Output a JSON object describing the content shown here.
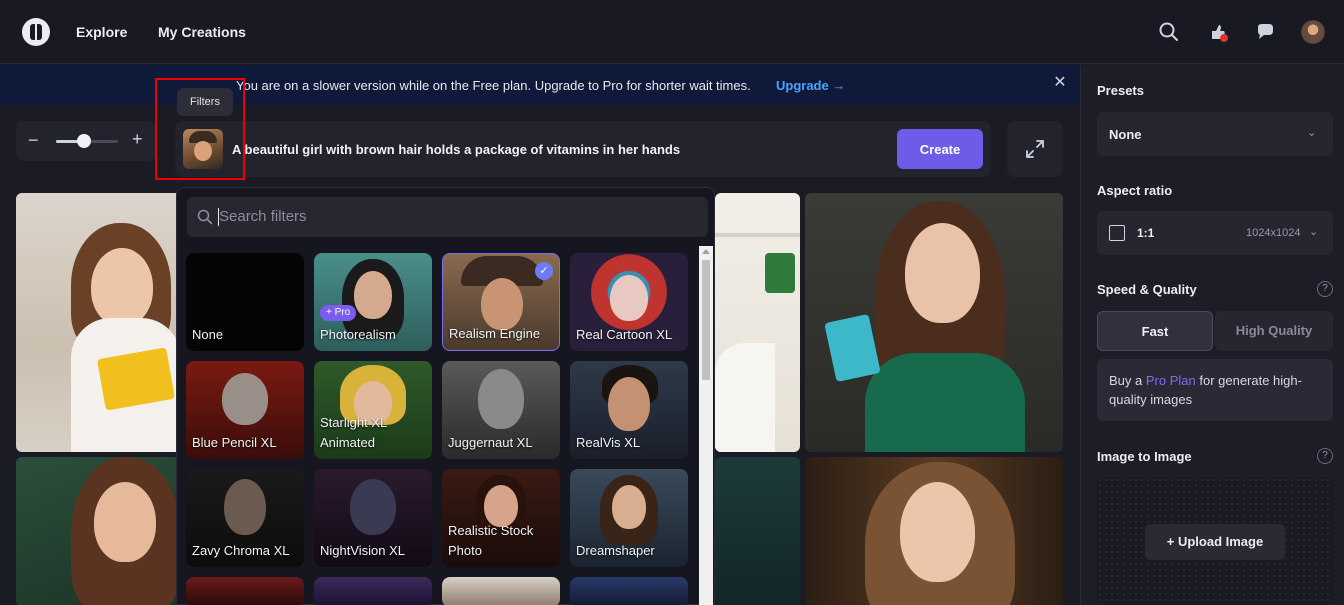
{
  "nav": {
    "explore": "Explore",
    "my_creations": "My Creations"
  },
  "banner": {
    "text": "You are on a slower version while on the Free plan. Upgrade to Pro for shorter wait times.",
    "link": "Upgrade →"
  },
  "zoom": {
    "level": 0.45
  },
  "filters_tooltip": "Filters",
  "prompt": {
    "text": "A beautiful girl with brown hair holds a package of vitamins in her hands",
    "create_label": "Create"
  },
  "filters": {
    "search_placeholder": "Search filters",
    "items": [
      {
        "label": "None"
      },
      {
        "label": "Photorealism",
        "badge": "+ Pro"
      },
      {
        "label": "Realism Engine",
        "selected": true,
        "check": "✓"
      },
      {
        "label": "Real Cartoon XL"
      },
      {
        "label": "Blue Pencil XL"
      },
      {
        "label": "Starlight XL Animated"
      },
      {
        "label": "Juggernaut XL"
      },
      {
        "label": "RealVis XL"
      },
      {
        "label": "Zavy Chroma XL"
      },
      {
        "label": "NightVision XL"
      },
      {
        "label": "Realistic Stock Photo"
      },
      {
        "label": "Dreamshaper"
      }
    ]
  },
  "panel": {
    "presets_label": "Presets",
    "presets_value": "None",
    "aspect_label": "Aspect ratio",
    "aspect_value": "1:1",
    "aspect_size": "1024x1024",
    "speed_label": "Speed & Quality",
    "help": "?",
    "fast_label": "Fast",
    "hq_label": "High Quality",
    "info_prefix": "Buy a ",
    "info_link": "Pro Plan",
    "info_suffix": " for generate high-quality images",
    "i2i_label": "Image to Image",
    "upload_label": "+ Upload Image"
  },
  "colors": {
    "accent": "#6c5ce7",
    "banner_link": "#4aa3ff",
    "highlight": "#ee0000"
  }
}
